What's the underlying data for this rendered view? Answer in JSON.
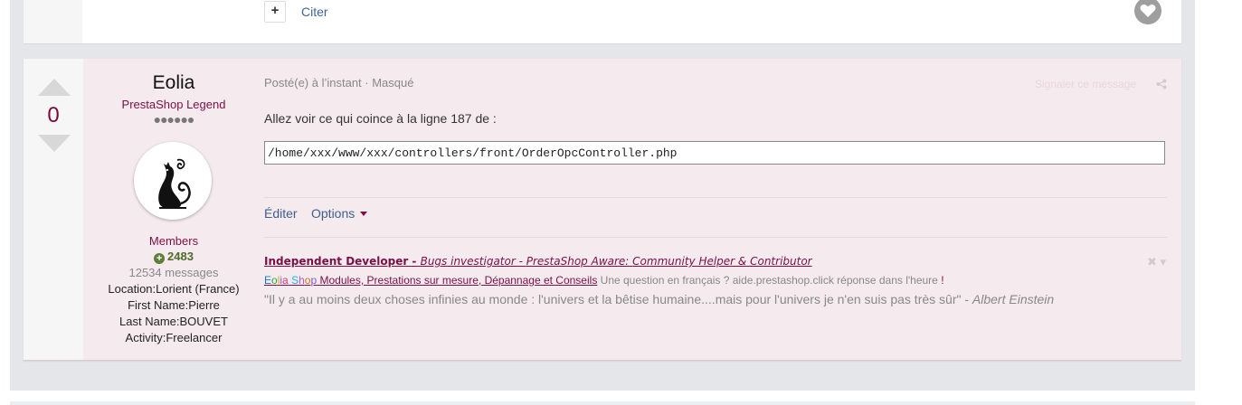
{
  "prev_post": {
    "plus_label": "+",
    "cite_label": "Citer"
  },
  "post": {
    "vote_count": "0",
    "author": {
      "name": "Eolia",
      "rank": "PrestaShop Legend",
      "rank_dots": "●●●●●●",
      "group": "Members",
      "reputation": "2483",
      "messages": "12534 messages",
      "location": "Location:Lorient (France)",
      "first_name": "First Name:Pierre",
      "last_name": "Last Name:BOUVET",
      "activity": "Activity:Freelancer"
    },
    "meta": "Posté(e) à l’instant · Masqué",
    "report_label": "Signaler ce message",
    "body_text": "Allez voir ce qui coince à la ligne 187 de :",
    "code_path": "/home/xxx/www/xxx/controllers/front/OrderOpcController.php",
    "actions": {
      "edit": "Éditer",
      "options": "Options"
    },
    "signature": {
      "line1_bold": "Independent Developer - ",
      "line1_italic1": "Bugs investigator - ",
      "line1_italic2": "PrestaShop Aware: ",
      "line1_italic3": "Community Helper & Contributor",
      "brand_letters": [
        "E",
        "o",
        "l",
        "i",
        "a",
        " ",
        "S",
        "h",
        "o",
        "p"
      ],
      "line2_link": " Modules, Prestations sur mesure, Dépannage et Conseils",
      "line2_rest": " Une question en français ? aide.prestashop.click réponse dans l'heure ",
      "line2_bang": "!",
      "quote": "\"Il y a au moins deux choses infinies au monde : l'univers et la bêtise humaine....mais pour l'univers je n'en suis pas très sûr\" - ",
      "quote_author": "Albert Einstein",
      "ctrl": "✖ ▾"
    }
  },
  "colors": {
    "accent": "#7a1046",
    "link": "#3d5f8c",
    "post_bg": "#f5eaee",
    "page_bg": "#e5e6ea",
    "brand": [
      "#1f7bc1",
      "#2aa84a",
      "#e0a020",
      "#8a5cc8",
      "#d23b7a",
      "#ffffff",
      "#1fb5d6",
      "#b05cc8",
      "#e06a2a",
      "#7a5cc8"
    ]
  },
  "icons": [
    "plus-icon",
    "heart-icon",
    "upvote-arrow-icon",
    "downvote-arrow-icon",
    "reputation-plus-icon",
    "share-icon",
    "caret-down-icon",
    "close-icon"
  ]
}
